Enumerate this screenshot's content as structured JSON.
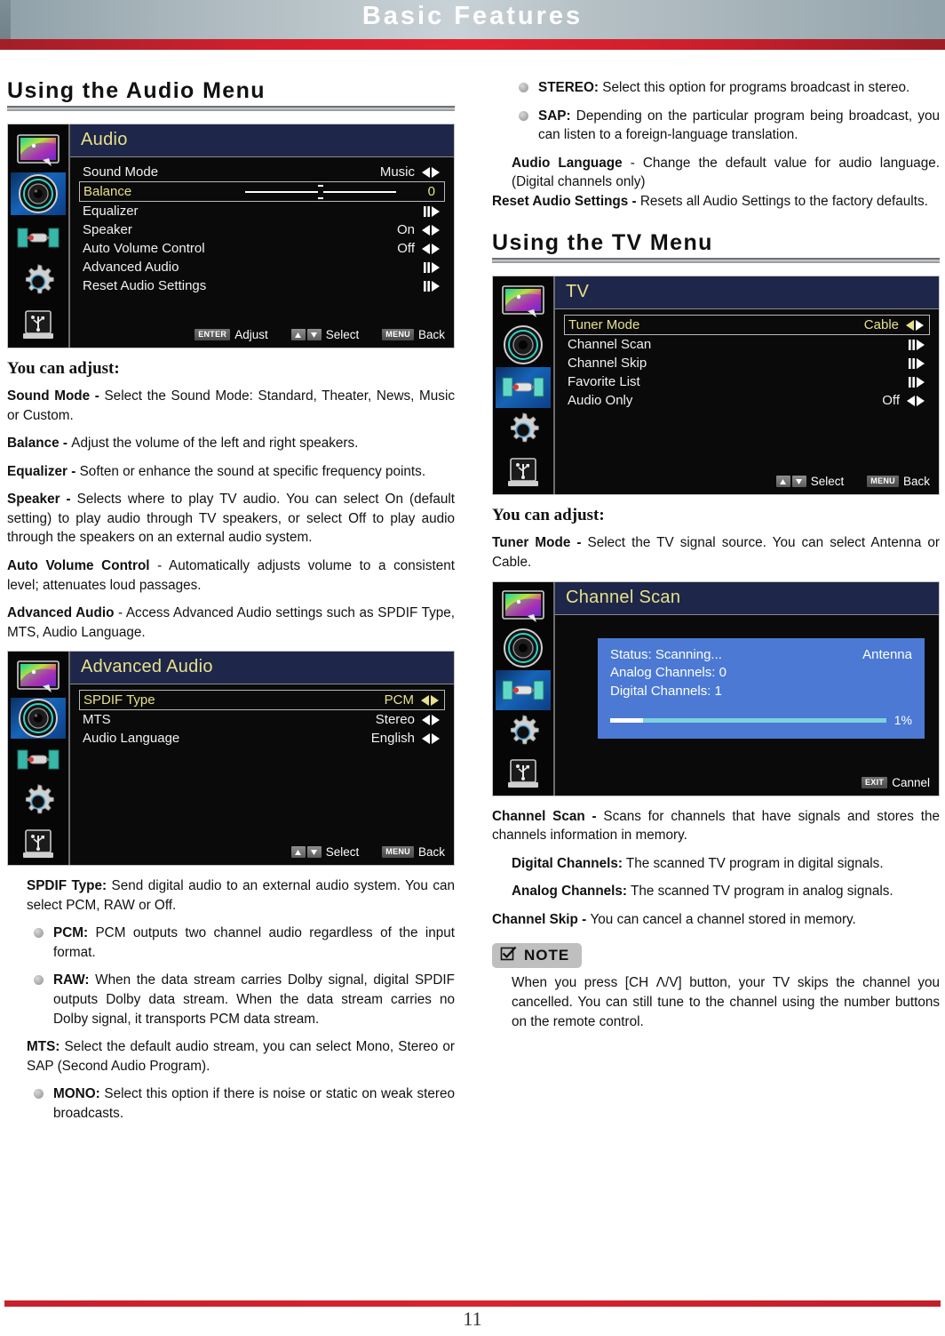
{
  "header": {
    "title": "Basic Features"
  },
  "footer": {
    "page_number": "11"
  },
  "left_column": {
    "heading": "Using the Audio Menu",
    "audio_osd": {
      "title": "Audio",
      "sidebar_icons": [
        "picture-icon",
        "audio-icon",
        "tv-tuner-icon",
        "settings-gear-icon",
        "usb-icon"
      ],
      "active_icon_index": 1,
      "rows": [
        {
          "label": "Sound Mode",
          "value": "Music",
          "control": "left-right-arrows",
          "selected": false
        },
        {
          "label": "Balance",
          "value": "0",
          "control": "slider",
          "selected": true
        },
        {
          "label": "Equalizer",
          "value": "",
          "control": "submenu-arrow",
          "selected": false
        },
        {
          "label": "Speaker",
          "value": "On",
          "control": "left-right-arrows",
          "selected": false
        },
        {
          "label": "Auto Volume Control",
          "value": "Off",
          "control": "left-right-arrows",
          "selected": false
        },
        {
          "label": "Advanced Audio",
          "value": "",
          "control": "submenu-arrow",
          "selected": false
        },
        {
          "label": "Reset Audio Settings",
          "value": "",
          "control": "submenu-arrow",
          "selected": false
        }
      ],
      "hints": [
        {
          "key": "ENTER",
          "action": "Adjust"
        },
        {
          "key": "updown",
          "action": "Select"
        },
        {
          "key": "MENU",
          "action": "Back"
        }
      ]
    },
    "you_can_adjust": "You can adjust:",
    "items": [
      {
        "term": "Sound Mode - ",
        "text": "Select the Sound Mode: Standard, Theater, News, Music or Custom."
      },
      {
        "term": "Balance - ",
        "text": "Adjust the volume of the left and right speakers."
      },
      {
        "term": "Equalizer - ",
        "text": "Soften or enhance the sound at specific frequency points."
      },
      {
        "term": "Speaker - ",
        "text": "Selects where to play TV audio. You can select On (default setting) to play audio through TV speakers, or select Off to play audio through the speakers on an external audio system."
      },
      {
        "term": "Auto Volume Control",
        "text": " - Automatically adjusts volume to a consistent level; attenuates loud passages."
      },
      {
        "term": "Advanced Audio",
        "text": " - Access Advanced Audio settings such as SPDIF Type, MTS, Audio Language."
      }
    ],
    "advanced_osd": {
      "title": "Advanced Audio",
      "sidebar_icons": [
        "picture-icon",
        "audio-icon",
        "tv-tuner-icon",
        "settings-gear-icon",
        "usb-icon"
      ],
      "active_icon_index": 1,
      "rows": [
        {
          "label": "SPDIF Type",
          "value": "PCM",
          "control": "left-right-arrows",
          "selected": true
        },
        {
          "label": "MTS",
          "value": "Stereo",
          "control": "left-right-arrows",
          "selected": false
        },
        {
          "label": "Audio Language",
          "value": "English",
          "control": "left-right-arrows",
          "selected": false
        }
      ],
      "hints": [
        {
          "key": "updown",
          "action": "Select"
        },
        {
          "key": "MENU",
          "action": "Back"
        }
      ]
    },
    "spdif_items": [
      {
        "term": "SPDIF Type:",
        "text": " Send digital audio to an external audio system. You can select PCM, RAW or Off."
      }
    ],
    "spdif_bullets": [
      {
        "term": "PCM:",
        "text": " PCM outputs two channel audio regardless of the input format."
      },
      {
        "term": "RAW:",
        "text": " When the data stream carries Dolby signal, digital SPDIF outputs Dolby data stream. When the data stream carries no Dolby signal, it transports PCM data stream."
      }
    ],
    "mts_item": {
      "term": "MTS:",
      "text": " Select the default audio stream, you can select Mono, Stereo or SAP (Second Audio Program)."
    },
    "mts_bullets": [
      {
        "term": "MONO:",
        "text": " Select this option if there is noise or static on weak stereo broadcasts."
      }
    ]
  },
  "right_column": {
    "mts_bullets": [
      {
        "term": "STEREO:",
        "text": " Select this option for programs broadcast in stereo."
      },
      {
        "term": "SAP:",
        "text": " Depending on the particular program being broadcast, you can listen to a foreign-language translation."
      }
    ],
    "audio_language_item": {
      "term": "Audio Language",
      "text": " - Change the default value for audio language. (Digital channels only)"
    },
    "reset_item": {
      "term": "Reset Audio Settings - ",
      "text": "Resets all Audio Settings to the factory defaults."
    },
    "heading": "Using the TV Menu",
    "tv_osd": {
      "title": "TV",
      "sidebar_icons": [
        "picture-icon",
        "audio-icon",
        "tv-tuner-icon",
        "settings-gear-icon",
        "usb-icon"
      ],
      "active_icon_index": 2,
      "rows": [
        {
          "label": "Tuner Mode",
          "value": "Cable",
          "control": "left-right-arrows",
          "selected": true
        },
        {
          "label": "Channel Scan",
          "value": "",
          "control": "submenu-arrow",
          "selected": false
        },
        {
          "label": "Channel Skip",
          "value": "",
          "control": "submenu-arrow",
          "selected": false
        },
        {
          "label": "Favorite List",
          "value": "",
          "control": "submenu-arrow",
          "selected": false
        },
        {
          "label": "Audio Only",
          "value": "Off",
          "control": "left-right-arrows",
          "selected": false
        }
      ],
      "hints": [
        {
          "key": "updown",
          "action": "Select"
        },
        {
          "key": "MENU",
          "action": "Back"
        }
      ]
    },
    "you_can_adjust": "You can adjust:",
    "tuner_item": {
      "term": "Tuner Mode - ",
      "text": "Select the TV signal source. You can select Antenna or Cable."
    },
    "scan_osd": {
      "title": "Channel Scan",
      "sidebar_icons": [
        "picture-icon",
        "audio-icon",
        "tv-tuner-icon",
        "settings-gear-icon",
        "usb-icon"
      ],
      "active_icon_index": 2,
      "status_label": "Status: Scanning...",
      "source": "Antenna",
      "analog_label": "Analog Channels: 0",
      "digital_label": "Digital Channels: 1",
      "progress_percent": "1%",
      "progress_fill_width": "12%",
      "hints": [
        {
          "key": "EXIT",
          "action": "Cannel"
        }
      ]
    },
    "scan_items": [
      {
        "term": "Channel Scan - ",
        "text": "Scans for channels that have signals and stores the channels information in memory."
      }
    ],
    "scan_subitems": [
      {
        "term": "Digital Channels:",
        "text": " The scanned TV program in digital signals."
      },
      {
        "term": "Analog Channels:",
        "text": " The scanned TV program in analog signals."
      }
    ],
    "skip_item": {
      "term": "Channel Skip - ",
      "text": "You can cancel a channel stored in memory."
    },
    "note": {
      "label": "NOTE",
      "text": "When you press [CH Λ/V] button, your TV skips the channel you cancelled. You can still tune to the channel using the number buttons on the remote control."
    }
  }
}
